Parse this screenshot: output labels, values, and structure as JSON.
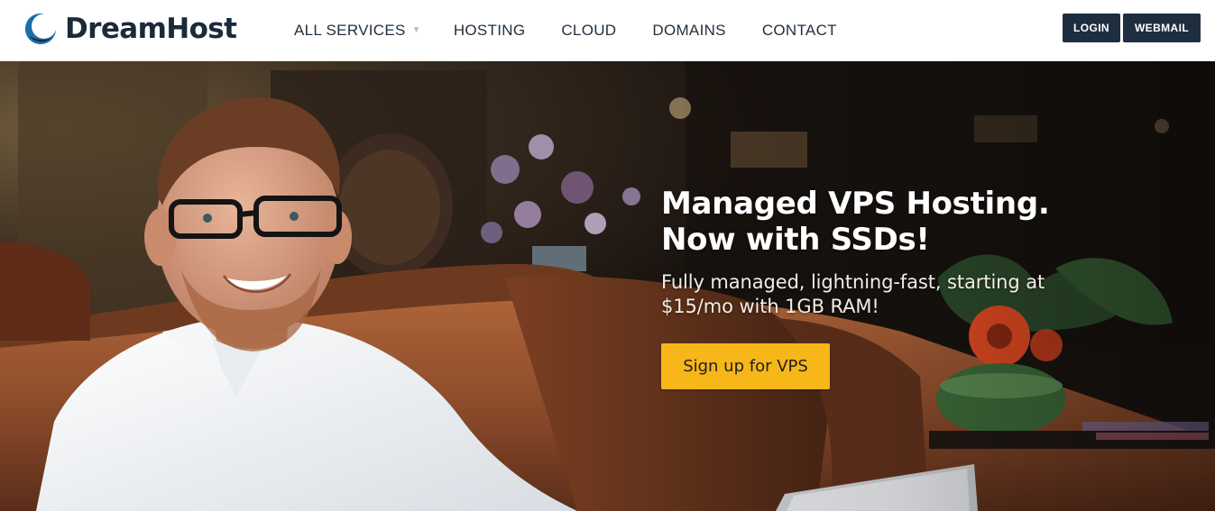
{
  "brand": {
    "name": "DreamHost",
    "logo_icon": "dreamhost-crescent-logo-icon",
    "colors": {
      "brand_navy": "#1e2e40",
      "brand_blue": "#1d6fa8",
      "cta_yellow": "#f7b718"
    }
  },
  "nav": {
    "items": [
      {
        "label": "ALL SERVICES",
        "has_dropdown": true,
        "dropdown_icon": "chevron-down-icon"
      },
      {
        "label": "HOSTING"
      },
      {
        "label": "CLOUD"
      },
      {
        "label": "DOMAINS"
      },
      {
        "label": "CONTACT"
      }
    ]
  },
  "auth": {
    "login_label": "LOGIN",
    "webmail_label": "WEBMAIL"
  },
  "hero": {
    "headline_line1": "Managed VPS Hosting.",
    "headline_line2": "Now with SSDs!",
    "subhead": "Fully managed, lightning-fast, starting at $15/mo with 1GB RAM!",
    "cta_label": "Sign up for VPS",
    "image_subject": "smiling-man-on-leather-couch-photo"
  }
}
